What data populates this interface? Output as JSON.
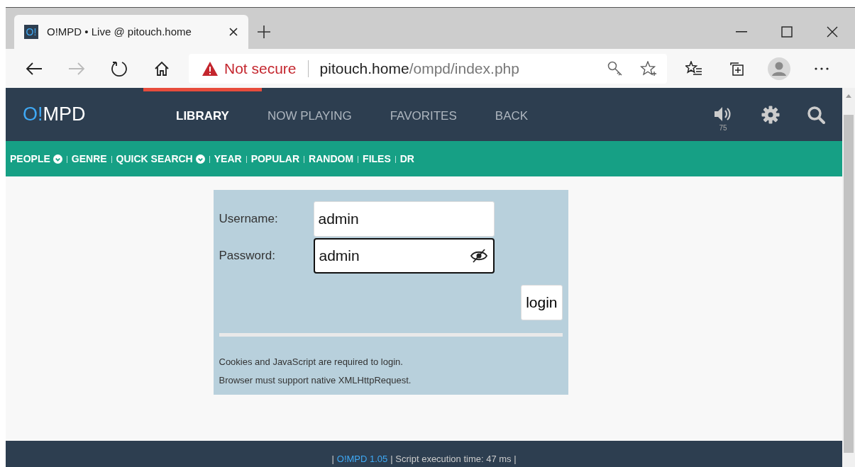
{
  "browser": {
    "tab": {
      "title": "O!MPD • Live @ pitouch.home",
      "favicon": "O!"
    },
    "address": {
      "warning": "Not secure",
      "host": "pitouch.home",
      "path": "/ompd/index.php"
    }
  },
  "header": {
    "logo_accent": "O!",
    "logo_rest": "MPD",
    "tabs": [
      {
        "label": "LIBRARY",
        "selected": true
      },
      {
        "label": "NOW PLAYING",
        "selected": false
      },
      {
        "label": "FAVORITES",
        "selected": false
      },
      {
        "label": "BACK",
        "selected": false
      }
    ],
    "volume": "75"
  },
  "subnav": [
    {
      "label": "PEOPLE",
      "dropdown": true
    },
    {
      "label": "GENRE",
      "dropdown": false
    },
    {
      "label": "QUICK SEARCH",
      "dropdown": true
    },
    {
      "label": "YEAR",
      "dropdown": false
    },
    {
      "label": "POPULAR",
      "dropdown": false
    },
    {
      "label": "RANDOM",
      "dropdown": false
    },
    {
      "label": "FILES",
      "dropdown": false
    },
    {
      "label": "DR",
      "dropdown": false
    }
  ],
  "login": {
    "fields": [
      {
        "label": "Username:",
        "value": "admin",
        "kind": "text",
        "focused": false
      },
      {
        "label": "Password:",
        "value": "admin",
        "kind": "password",
        "focused": true
      }
    ],
    "button": "login",
    "notes": [
      "Cookies and JavaScript are required to login.",
      "Browser must support native XMLHttpRequest."
    ]
  },
  "footer": {
    "lead": "|",
    "link": "O!MPD 1.05",
    "rest": "| Script execution time: 47 ms |"
  }
}
